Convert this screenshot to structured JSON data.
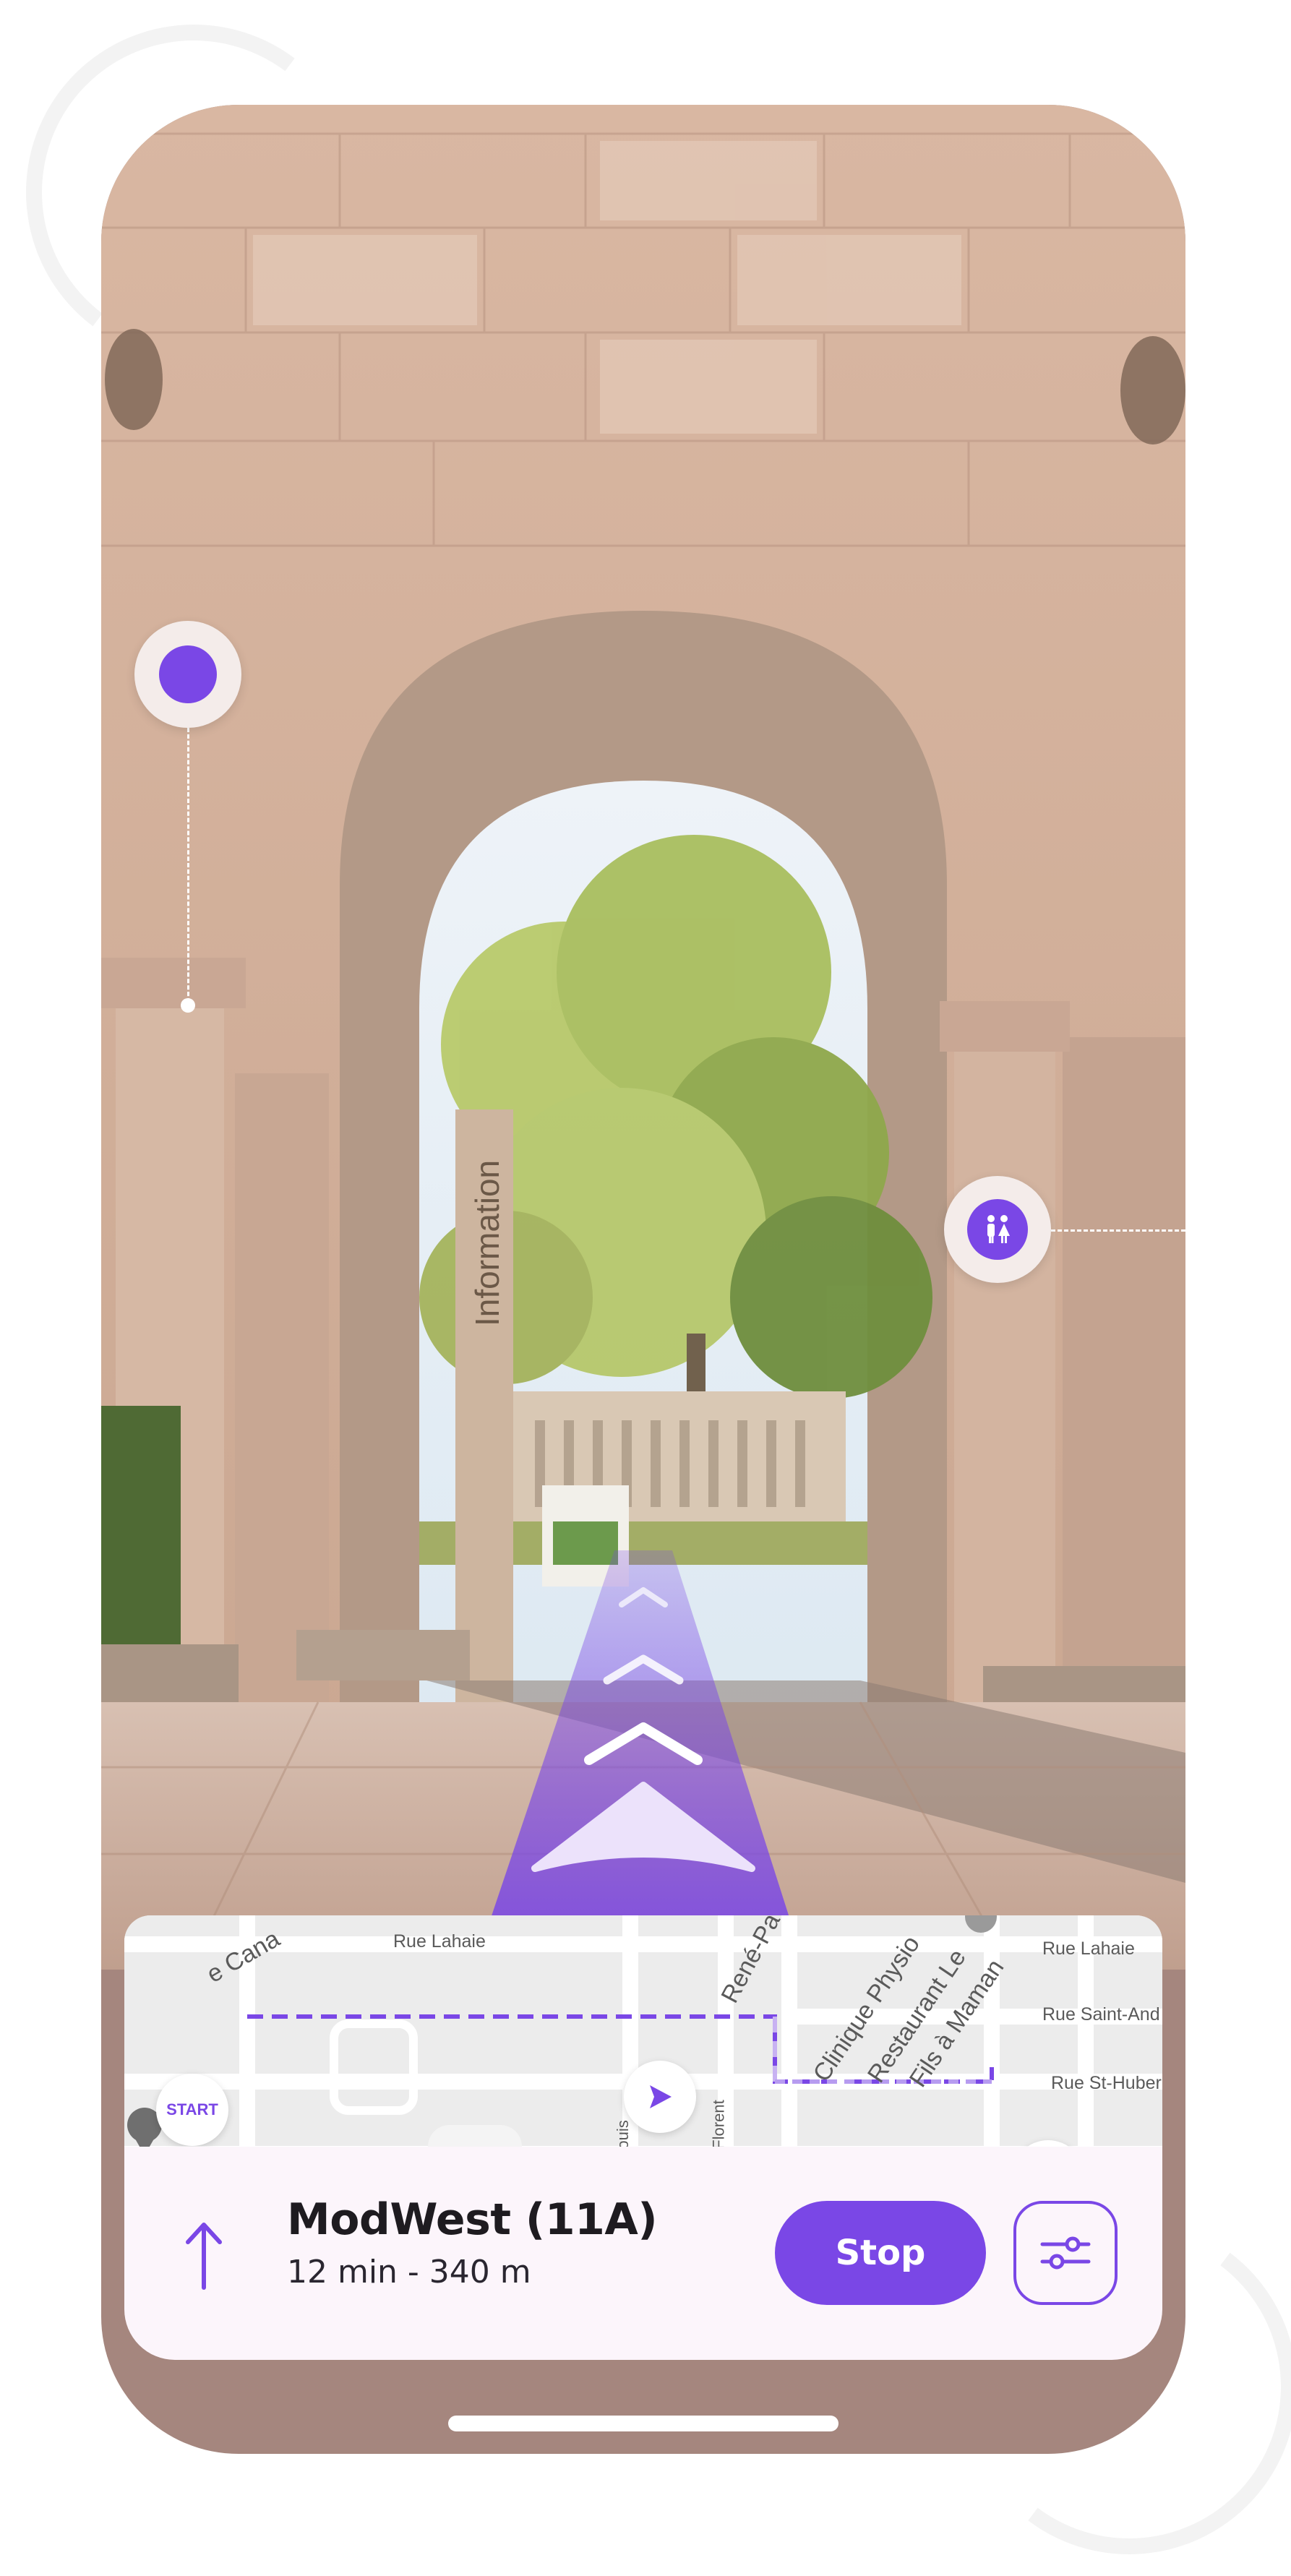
{
  "theme": {
    "accent": "#7a47e6",
    "accent_light": "#d7c7f4",
    "frame": "#a5867e",
    "panel": "#fcf5fb"
  },
  "ar_scene": {
    "sign_text": "Information",
    "markers": [
      {
        "icon": "location-dot-icon"
      },
      {
        "icon": "restroom-icon"
      }
    ],
    "direction_arrows": [
      "chevron-up-icon",
      "chevron-up-icon",
      "chevron-up-icon",
      "big-arrow-icon"
    ]
  },
  "map": {
    "start_label": "START",
    "street_labels": {
      "rue_lahaie_top": "Rue Lahaie",
      "rue_lahaie_right": "Rue Lahaie",
      "rue_saint_and": "Rue Saint-And",
      "rue_st_hubert": "Rue St-Huber",
      "st_louis": "St Louis",
      "st_florent": "St Florent",
      "rene_pa": "René-Pa",
      "ce_canal": "e Cana",
      "clinique": "Clinique Physio",
      "restaurant": "Restaurant Le",
      "fils_a_maman": "Fils à Maman"
    }
  },
  "navigation": {
    "destination": "ModWest (11A)",
    "eta": "12 min - 340 m",
    "stop_label": "Stop",
    "direction_icon": "arrow-up-icon",
    "settings_icon": "sliders-icon"
  }
}
